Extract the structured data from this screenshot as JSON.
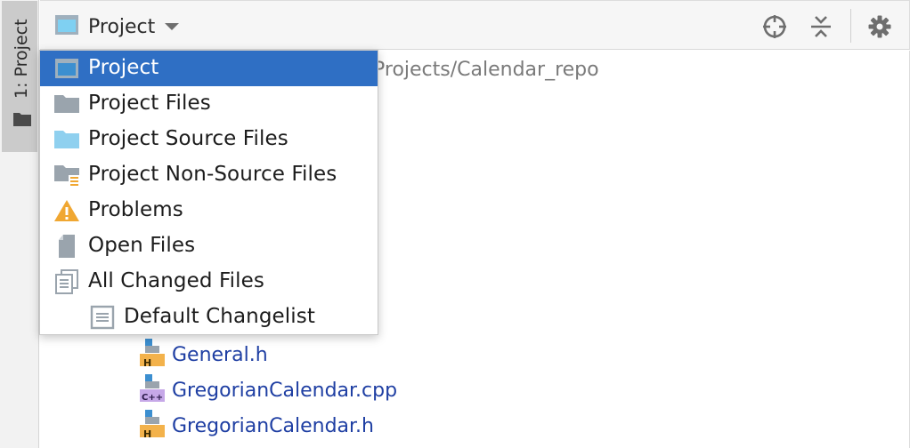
{
  "stripe": {
    "tab_label": "1: Project"
  },
  "header": {
    "view_title": "Project"
  },
  "tree": {
    "path": "Projects/Calendar_repo",
    "files": [
      {
        "name": "General.h",
        "badge": "H"
      },
      {
        "name": "GregorianCalendar.cpp",
        "badge": "C++"
      },
      {
        "name": "GregorianCalendar.h",
        "badge": "H"
      }
    ]
  },
  "menu": {
    "items": [
      {
        "label": "Project",
        "icon": "project-window-icon",
        "selected": true
      },
      {
        "label": "Project Files",
        "icon": "folder-icon"
      },
      {
        "label": "Project Source Files",
        "icon": "source-folder-icon"
      },
      {
        "label": "Project Non-Source Files",
        "icon": "non-source-folder-icon"
      },
      {
        "label": "Problems",
        "icon": "warning-icon"
      },
      {
        "label": "Open Files",
        "icon": "file-icon"
      },
      {
        "label": "All Changed Files",
        "icon": "changed-files-icon"
      },
      {
        "label": "Default Changelist",
        "icon": "changelist-icon"
      }
    ]
  },
  "colors": {
    "selection": "#2f6fc4",
    "link_text": "#1f3fa3",
    "warning": "#f0a732",
    "source_folder": "#8fd0ef",
    "folder": "#9aa4ad"
  }
}
